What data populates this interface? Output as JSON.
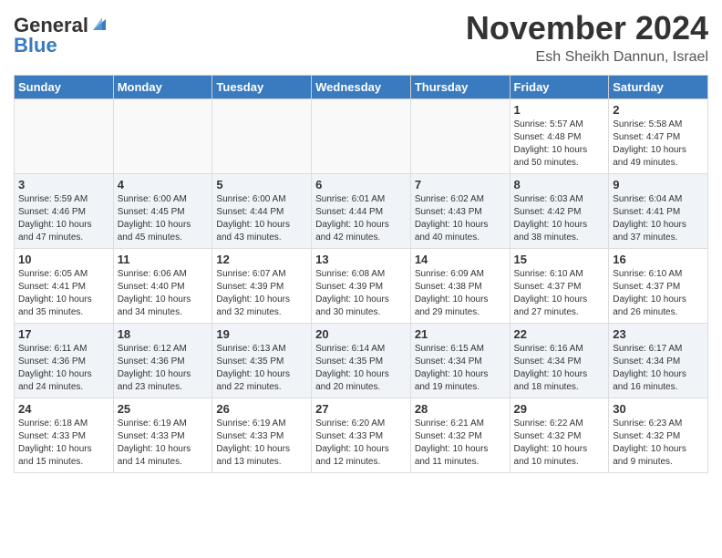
{
  "header": {
    "logo_general": "General",
    "logo_blue": "Blue",
    "month_title": "November 2024",
    "location": "Esh Sheikh Dannun, Israel"
  },
  "weekdays": [
    "Sunday",
    "Monday",
    "Tuesday",
    "Wednesday",
    "Thursday",
    "Friday",
    "Saturday"
  ],
  "weeks": [
    [
      {
        "day": "",
        "info": ""
      },
      {
        "day": "",
        "info": ""
      },
      {
        "day": "",
        "info": ""
      },
      {
        "day": "",
        "info": ""
      },
      {
        "day": "",
        "info": ""
      },
      {
        "day": "1",
        "info": "Sunrise: 5:57 AM\nSunset: 4:48 PM\nDaylight: 10 hours and 50 minutes."
      },
      {
        "day": "2",
        "info": "Sunrise: 5:58 AM\nSunset: 4:47 PM\nDaylight: 10 hours and 49 minutes."
      }
    ],
    [
      {
        "day": "3",
        "info": "Sunrise: 5:59 AM\nSunset: 4:46 PM\nDaylight: 10 hours and 47 minutes."
      },
      {
        "day": "4",
        "info": "Sunrise: 6:00 AM\nSunset: 4:45 PM\nDaylight: 10 hours and 45 minutes."
      },
      {
        "day": "5",
        "info": "Sunrise: 6:00 AM\nSunset: 4:44 PM\nDaylight: 10 hours and 43 minutes."
      },
      {
        "day": "6",
        "info": "Sunrise: 6:01 AM\nSunset: 4:44 PM\nDaylight: 10 hours and 42 minutes."
      },
      {
        "day": "7",
        "info": "Sunrise: 6:02 AM\nSunset: 4:43 PM\nDaylight: 10 hours and 40 minutes."
      },
      {
        "day": "8",
        "info": "Sunrise: 6:03 AM\nSunset: 4:42 PM\nDaylight: 10 hours and 38 minutes."
      },
      {
        "day": "9",
        "info": "Sunrise: 6:04 AM\nSunset: 4:41 PM\nDaylight: 10 hours and 37 minutes."
      }
    ],
    [
      {
        "day": "10",
        "info": "Sunrise: 6:05 AM\nSunset: 4:41 PM\nDaylight: 10 hours and 35 minutes."
      },
      {
        "day": "11",
        "info": "Sunrise: 6:06 AM\nSunset: 4:40 PM\nDaylight: 10 hours and 34 minutes."
      },
      {
        "day": "12",
        "info": "Sunrise: 6:07 AM\nSunset: 4:39 PM\nDaylight: 10 hours and 32 minutes."
      },
      {
        "day": "13",
        "info": "Sunrise: 6:08 AM\nSunset: 4:39 PM\nDaylight: 10 hours and 30 minutes."
      },
      {
        "day": "14",
        "info": "Sunrise: 6:09 AM\nSunset: 4:38 PM\nDaylight: 10 hours and 29 minutes."
      },
      {
        "day": "15",
        "info": "Sunrise: 6:10 AM\nSunset: 4:37 PM\nDaylight: 10 hours and 27 minutes."
      },
      {
        "day": "16",
        "info": "Sunrise: 6:10 AM\nSunset: 4:37 PM\nDaylight: 10 hours and 26 minutes."
      }
    ],
    [
      {
        "day": "17",
        "info": "Sunrise: 6:11 AM\nSunset: 4:36 PM\nDaylight: 10 hours and 24 minutes."
      },
      {
        "day": "18",
        "info": "Sunrise: 6:12 AM\nSunset: 4:36 PM\nDaylight: 10 hours and 23 minutes."
      },
      {
        "day": "19",
        "info": "Sunrise: 6:13 AM\nSunset: 4:35 PM\nDaylight: 10 hours and 22 minutes."
      },
      {
        "day": "20",
        "info": "Sunrise: 6:14 AM\nSunset: 4:35 PM\nDaylight: 10 hours and 20 minutes."
      },
      {
        "day": "21",
        "info": "Sunrise: 6:15 AM\nSunset: 4:34 PM\nDaylight: 10 hours and 19 minutes."
      },
      {
        "day": "22",
        "info": "Sunrise: 6:16 AM\nSunset: 4:34 PM\nDaylight: 10 hours and 18 minutes."
      },
      {
        "day": "23",
        "info": "Sunrise: 6:17 AM\nSunset: 4:34 PM\nDaylight: 10 hours and 16 minutes."
      }
    ],
    [
      {
        "day": "24",
        "info": "Sunrise: 6:18 AM\nSunset: 4:33 PM\nDaylight: 10 hours and 15 minutes."
      },
      {
        "day": "25",
        "info": "Sunrise: 6:19 AM\nSunset: 4:33 PM\nDaylight: 10 hours and 14 minutes."
      },
      {
        "day": "26",
        "info": "Sunrise: 6:19 AM\nSunset: 4:33 PM\nDaylight: 10 hours and 13 minutes."
      },
      {
        "day": "27",
        "info": "Sunrise: 6:20 AM\nSunset: 4:33 PM\nDaylight: 10 hours and 12 minutes."
      },
      {
        "day": "28",
        "info": "Sunrise: 6:21 AM\nSunset: 4:32 PM\nDaylight: 10 hours and 11 minutes."
      },
      {
        "day": "29",
        "info": "Sunrise: 6:22 AM\nSunset: 4:32 PM\nDaylight: 10 hours and 10 minutes."
      },
      {
        "day": "30",
        "info": "Sunrise: 6:23 AM\nSunset: 4:32 PM\nDaylight: 10 hours and 9 minutes."
      }
    ]
  ]
}
